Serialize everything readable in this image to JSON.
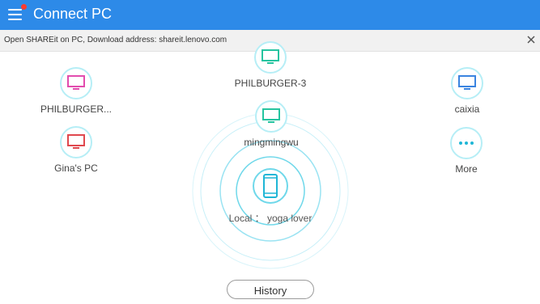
{
  "header": {
    "title": "Connect PC",
    "menu_icon": "menu-icon",
    "has_notification": true
  },
  "notice": {
    "text": "Open SHAREit on PC, Download address: shareit.lenovo.com",
    "close_icon": "close-icon"
  },
  "devices": [
    {
      "name": "PHILBURGER-3",
      "icon": "monitor-icon",
      "color": "#26c4a0"
    },
    {
      "name": "PHILBURGER...",
      "icon": "monitor-icon",
      "color": "#e24cae"
    },
    {
      "name": "caixia",
      "icon": "monitor-icon",
      "color": "#3a84e0"
    },
    {
      "name": "mingmingwu",
      "icon": "monitor-icon",
      "color": "#26c4a0"
    },
    {
      "name": "Gina's PC",
      "icon": "monitor-icon",
      "color": "#e0484e"
    }
  ],
  "more": {
    "label": "More",
    "icon": "more-icon",
    "color": "#1fb6d6"
  },
  "local": {
    "label": "Local ： yoga lover",
    "icon": "phone-icon",
    "color": "#1fb6d6"
  },
  "history_button": "History",
  "colors": {
    "header_bg": "#2d8ae8",
    "notice_bg": "#f1f1f1",
    "ring": "#b6eef6"
  }
}
